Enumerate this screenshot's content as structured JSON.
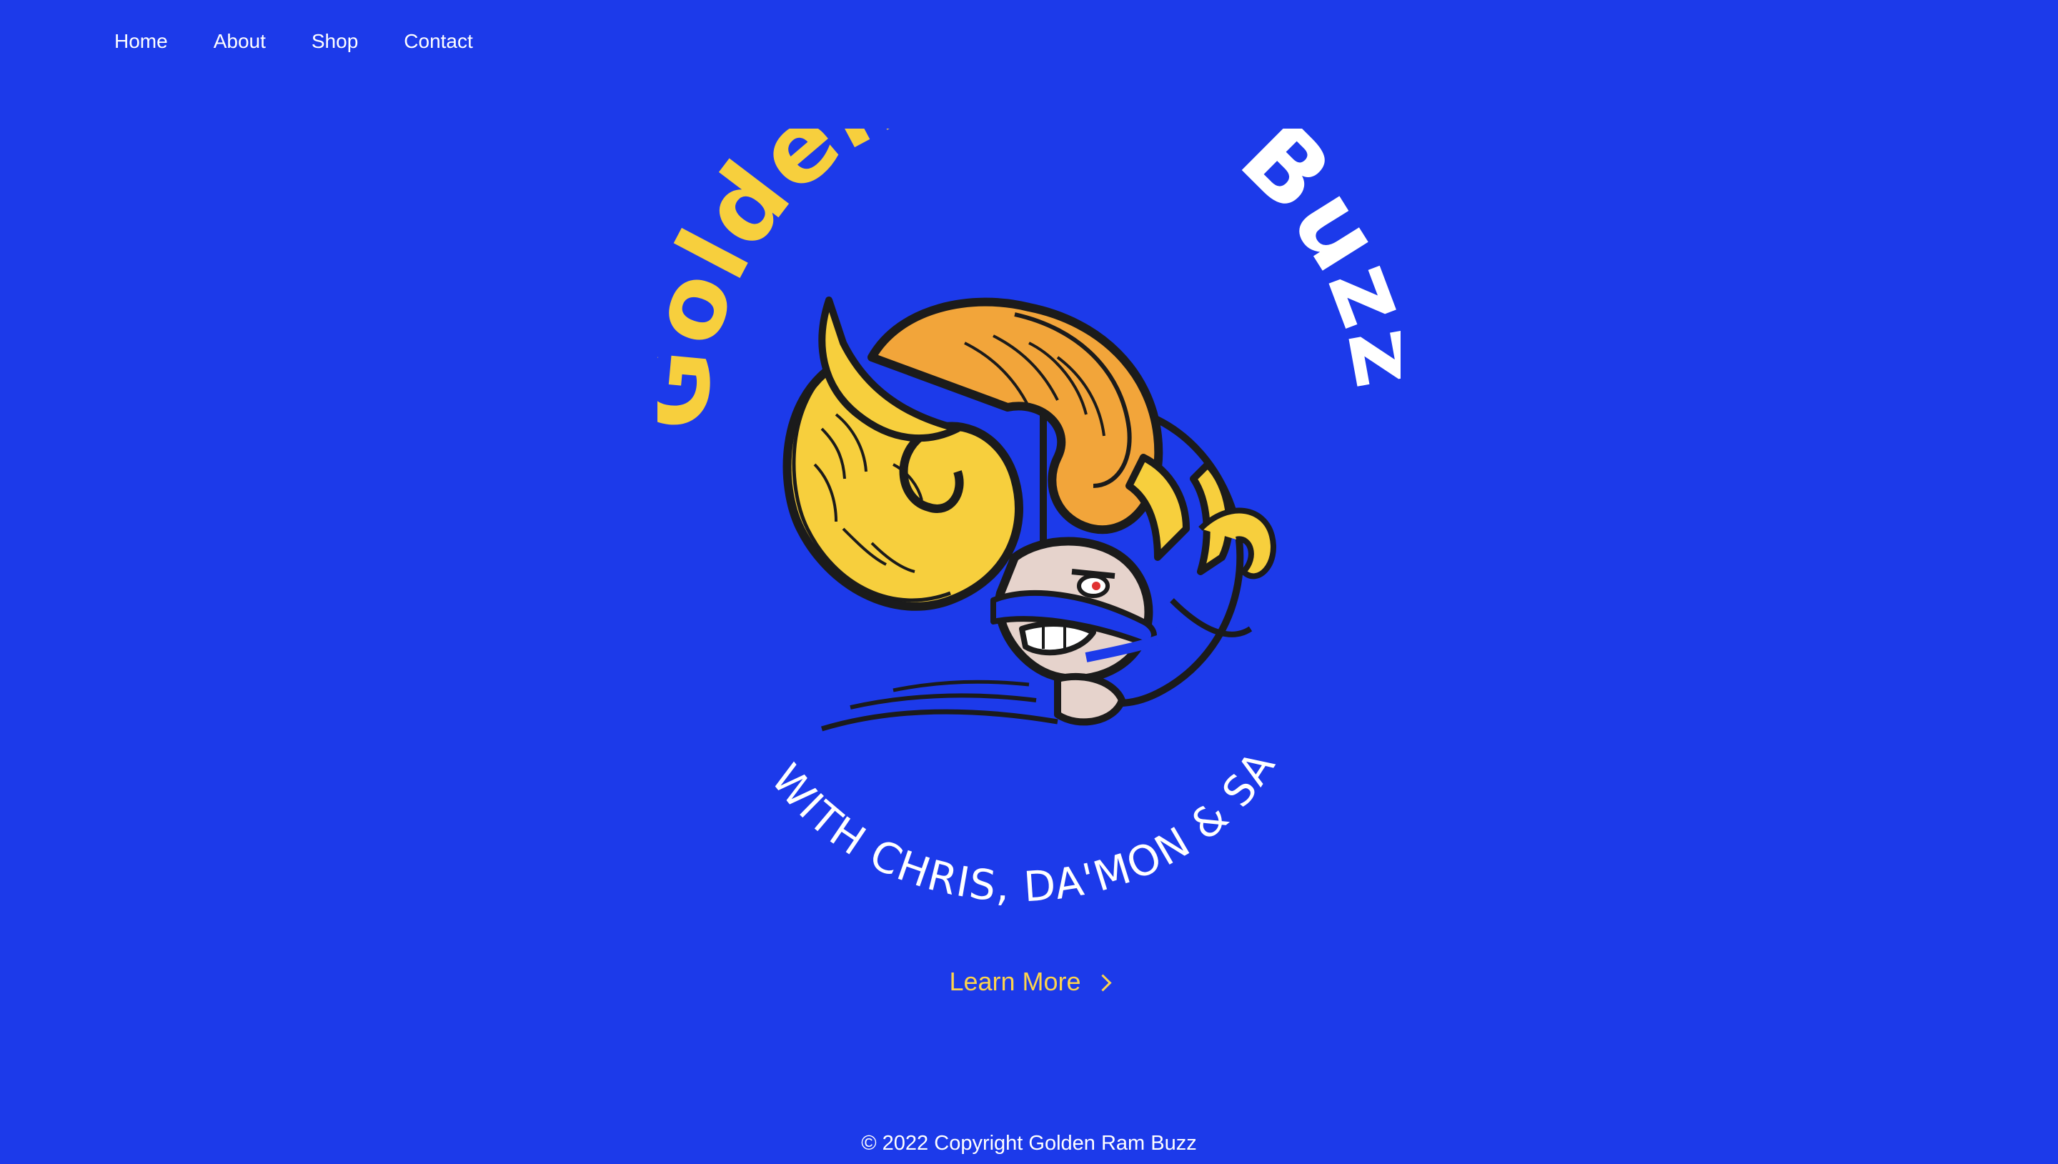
{
  "nav": {
    "items": [
      {
        "label": "Home"
      },
      {
        "label": "About"
      },
      {
        "label": "Shop"
      },
      {
        "label": "Contact"
      }
    ]
  },
  "logo": {
    "title_gold": "Golden Ram",
    "title_white": "Buzz",
    "subtitle": "WITH CHRIS, DA'MON & SAL",
    "colors": {
      "gold": "#f7cf3d",
      "orange": "#f2a53a",
      "white": "#ffffff",
      "ink": "#1b1b1b",
      "skin": "#e6d3cc"
    }
  },
  "cta": {
    "label": "Learn More",
    "icon": "chevron-right-icon"
  },
  "footer": {
    "text": "© 2022 Copyright Golden Ram Buzz"
  },
  "theme": {
    "background": "#1c3aea",
    "accent": "#fcd34d"
  }
}
